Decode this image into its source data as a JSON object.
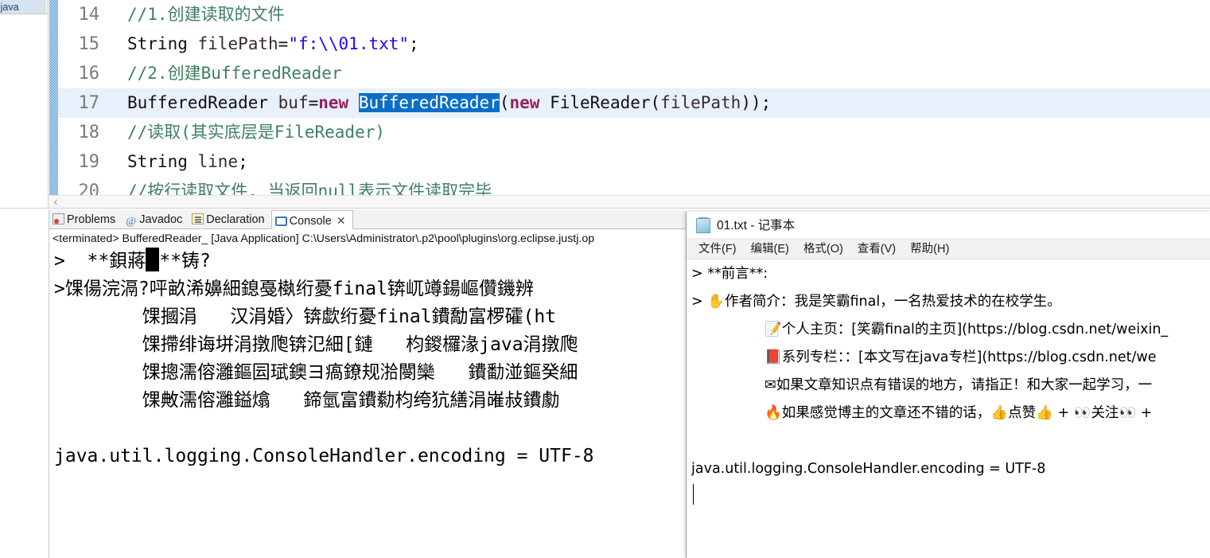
{
  "editor": {
    "tab_label": "r_.java",
    "hscroll_arrow": "‹",
    "lines": [
      {
        "num": "14",
        "indent": "    ",
        "segments": [
          {
            "cls": "tok-cmt",
            "text": "//1.创建读取的文件"
          }
        ]
      },
      {
        "num": "15",
        "indent": "    ",
        "segments": [
          {
            "cls": "tok-dflt",
            "text": "String "
          },
          {
            "cls": "tok-pln",
            "text": "filePath"
          },
          {
            "cls": "tok-dflt",
            "text": "="
          },
          {
            "cls": "tok-str",
            "text": "\"f:\\\\01.txt\""
          },
          {
            "cls": "tok-dflt",
            "text": ";"
          }
        ]
      },
      {
        "num": "16",
        "indent": "    ",
        "segments": [
          {
            "cls": "tok-cmt",
            "text": "//2.创建BufferedReader"
          }
        ]
      },
      {
        "num": "17",
        "indent": "    ",
        "active": true,
        "segments": [
          {
            "cls": "tok-dflt",
            "text": "BufferedReader "
          },
          {
            "cls": "tok-pln",
            "text": "buf"
          },
          {
            "cls": "tok-dflt",
            "text": "="
          },
          {
            "cls": "tok-kw",
            "text": "new"
          },
          {
            "cls": "tok-dflt",
            "text": " "
          },
          {
            "cls": "tok-sel",
            "text": "BufferedReader"
          },
          {
            "cls": "tok-dflt",
            "text": "("
          },
          {
            "cls": "tok-kw",
            "text": "new"
          },
          {
            "cls": "tok-dflt",
            "text": " FileReader("
          },
          {
            "cls": "tok-pln",
            "text": "filePath"
          },
          {
            "cls": "tok-dflt",
            "text": "));"
          }
        ]
      },
      {
        "num": "18",
        "indent": "    ",
        "segments": [
          {
            "cls": "tok-cmt",
            "text": "//读取(其实底层是FileReader)"
          }
        ]
      },
      {
        "num": "19",
        "indent": "    ",
        "segments": [
          {
            "cls": "tok-dflt",
            "text": "String "
          },
          {
            "cls": "tok-pln",
            "text": "line"
          },
          {
            "cls": "tok-dflt",
            "text": ";"
          }
        ]
      },
      {
        "num": "20",
        "indent": "    ",
        "segments": [
          {
            "cls": "tok-cmt",
            "text": "//按行读取文件, 当返回null表示文件读取完毕"
          }
        ]
      }
    ]
  },
  "console": {
    "tabs": [
      {
        "label": "Problems",
        "icon": "problems-icon",
        "selected": false
      },
      {
        "label": "Javadoc",
        "icon": "at-icon",
        "selected": false
      },
      {
        "label": "Declaration",
        "icon": "declaration-icon",
        "selected": false
      },
      {
        "label": "Console",
        "icon": "console-icon",
        "selected": true
      }
    ],
    "close_glyph": "✕",
    "launch_line": "<terminated> BufferedReader_ [Java Application] C:\\Users\\Administrator\\.p2\\pool\\plugins\\org.eclipse.justj.op",
    "output_lines": [
      {
        "text": ">  **鋇蔣",
        "caret": true,
        "after": "**铸?"
      },
      {
        "text": ">馃偒浣滆?呯畝浠嬶細鎴戞槸绗憂final锛屼竴鍚嶇儹鐖辨"
      },
      {
        "text": "        馃摑涓   汉涓婚〉锛歔绗憂final鐨勪富椤礭(ht"
      },
      {
        "text": "        馃摕绯诲垪涓撴爮锛氾細[鏈   枃鍐欏湪java涓撴爮"
      },
      {
        "text": "        馃摠濡傛灉鏂囩珷鐭ヨ瘑鐐规湁閿欒   鐨勫湴鏂癸細"
      },
      {
        "text": "        馃敟濡傛灉鎰熻   鍗氫富鐨勬枃绔犺繕涓嶉敊鐨勮"
      },
      {
        "text": ""
      },
      {
        "text": "java.util.logging.ConsoleHandler.encoding = UTF-8"
      }
    ]
  },
  "notepad": {
    "title": "01.txt - 记事本",
    "title_icon": "notepad-icon",
    "menus": [
      "文件(F)",
      "编辑(E)",
      "格式(O)",
      "查看(V)",
      "帮助(H)"
    ],
    "lines": [
      {
        "indent": false,
        "text": "> **前言**:"
      },
      {
        "indent": false,
        "text": "> ✋作者简介：我是笑霸final，一名热爱技术的在校学生。"
      },
      {
        "indent": true,
        "text": "📝个人主页：[笑霸final的主页](https://blog.csdn.net/weixin_"
      },
      {
        "indent": true,
        "text": "📕系列专栏：：[本文写在java专栏](https://blog.csdn.net/we"
      },
      {
        "indent": true,
        "text": "✉如果文章知识点有错误的地方，请指正！和大家一起学习，一"
      },
      {
        "indent": true,
        "text": "🔥如果感觉博主的文章还不错的话，👍点赞👍 + 👀关注👀 + "
      },
      {
        "indent": false,
        "text": ""
      },
      {
        "indent": false,
        "text": "java.util.logging.ConsoleHandler.encoding = UTF-8"
      },
      {
        "indent": false,
        "text": "",
        "caret": true
      }
    ]
  },
  "colors": {
    "comment": "#3f7f5f",
    "keyword": "#9b1d62",
    "string": "#2a00ff",
    "selection": "#0b6ec6",
    "active_line": "#e8f0fb",
    "change_ruler": "#2a83c6"
  }
}
